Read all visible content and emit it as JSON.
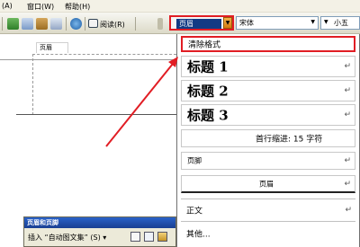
{
  "menu": {
    "items": [
      "(A)",
      "窗口(W)",
      "帮助(H)"
    ]
  },
  "toolbar": {
    "read_label": "阅读(R)",
    "style_value": "页眉",
    "font_value": "宋体",
    "size_value": "小五",
    "accent_color": "#e11d24",
    "selection_color": "#123a84"
  },
  "style_menu": {
    "clear_format": "清除格式",
    "heading1": "标题 1",
    "heading2": "标题 2",
    "heading3": "标题 3",
    "indent": "首行缩进: 15 字符",
    "footer": "页脚",
    "header": "页眉",
    "body_text": "正文",
    "other": "其他...",
    "enter_mark": "↵"
  },
  "document": {
    "header_label": "页眉"
  },
  "hf_toolbar": {
    "title": "页眉和页脚",
    "insert_autotext": "插入 “自动图文集” (S) ▾"
  },
  "icons": [
    "save-icon",
    "print-icon",
    "reading-icon",
    "header-footer-icon"
  ]
}
